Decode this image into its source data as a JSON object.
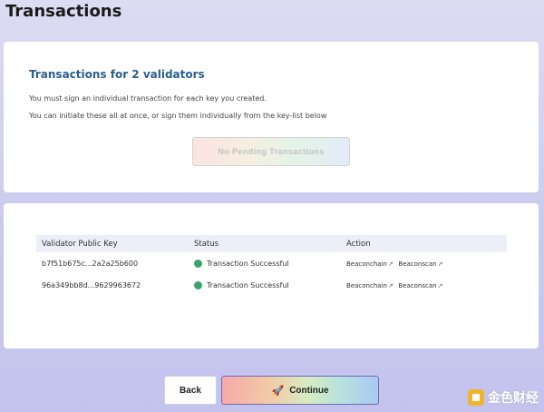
{
  "page": {
    "title": "Transactions"
  },
  "summary": {
    "heading": "Transactions for 2 validators",
    "line1": "You must sign an individual transaction for each key you created.",
    "line2": "You can initiate these all at once, or sign them individually from the key-list below",
    "pending_button_label": "No Pending Transactions"
  },
  "table": {
    "headers": {
      "key": "Validator Public Key",
      "status": "Status",
      "action": "Action"
    },
    "rows": [
      {
        "key": "b7f51b675c...2a2a25b600",
        "status": "Transaction Successful",
        "status_color": "#3aa46f",
        "link1": "Beaconchain",
        "link2": "Beaconscan"
      },
      {
        "key": "96a349bb8d...9629963672",
        "status": "Transaction Successful",
        "status_color": "#3aa46f",
        "link1": "Beaconchain",
        "link2": "Beaconscan"
      }
    ]
  },
  "footer": {
    "back_label": "Back",
    "continue_label": "Continue",
    "continue_icon": "rocket-icon"
  },
  "watermark": {
    "text": "金色财经"
  }
}
